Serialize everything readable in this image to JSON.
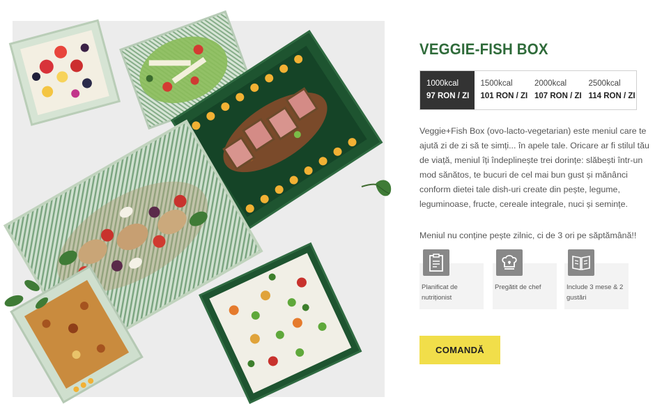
{
  "product": {
    "title": "VEGGIE-FISH BOX"
  },
  "plans": [
    {
      "kcal": "1000kcal",
      "price": "97 RON / ZI",
      "active": true
    },
    {
      "kcal": "1500kcal",
      "price": "101 RON / ZI",
      "active": false
    },
    {
      "kcal": "2000kcal",
      "price": "107 RON / ZI",
      "active": false
    },
    {
      "kcal": "2500kcal",
      "price": "114 RON / ZI",
      "active": false
    }
  ],
  "description": "Veggie+Fish Box (ovo-lacto-vegetarian) este meniul care te ajută zi de zi să te simți... în apele tale. Oricare ar fi stilul tău de viață, meniul îți îndeplinește trei dorințe: slăbești într-un mod sănătos, te bucuri de cel mai bun gust și mănânci conform dietei tale dish-uri create din pește, legume, leguminoase, fructe, cereale integrale, nuci și semințe.",
  "note": "Meniul nu conține pește zilnic, ci de 3 ori pe săptămână!!",
  "features": [
    {
      "icon": "clipboard-icon",
      "label": "Planificat de nutriționist"
    },
    {
      "icon": "chef-hat-icon",
      "label": "Pregătit de chef"
    },
    {
      "icon": "menu-book-icon",
      "label": "Include 3 mese & 2 gustări"
    }
  ],
  "actions": {
    "order_label": "COMANDĂ"
  },
  "colors": {
    "title_green": "#2f6b3a",
    "active_plan_bg": "#333333",
    "order_button": "#f1de4a",
    "feature_icon_bg": "#888888"
  }
}
